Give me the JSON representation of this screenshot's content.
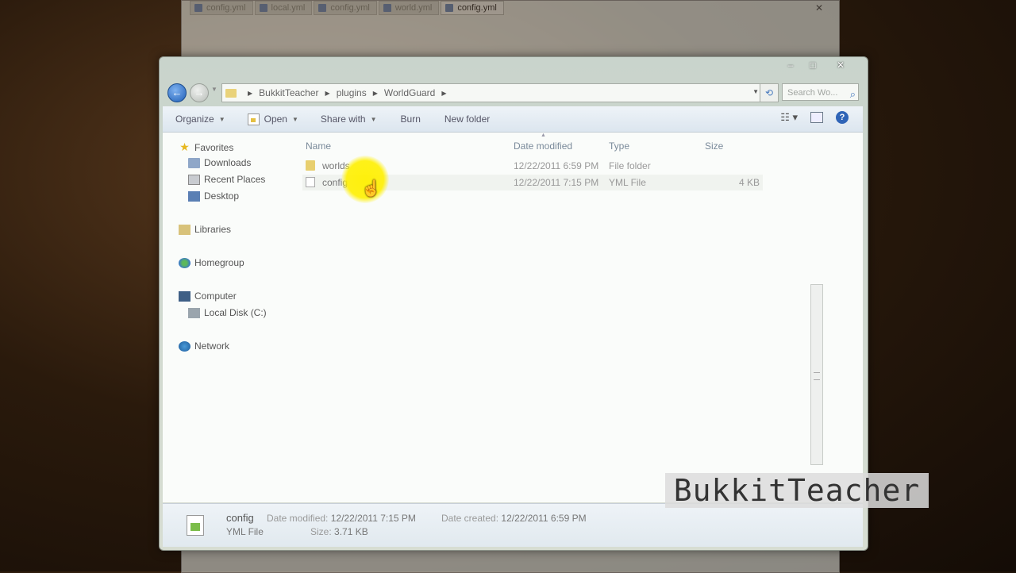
{
  "background_window": {
    "tabs": [
      "config.yml",
      "local.yml",
      "config.yml",
      "world.yml",
      "config.yml"
    ],
    "close_label": "✕"
  },
  "window": {
    "caption_minimize": "–",
    "caption_maximize": "□",
    "caption_close": "✕"
  },
  "address_bar": {
    "crumbs": [
      "BukkitTeacher",
      "plugins",
      "WorldGuard"
    ],
    "search_placeholder": "Search Wo..."
  },
  "toolbar": {
    "organize": "Organize",
    "open": "Open",
    "share_with": "Share with",
    "burn": "Burn",
    "new_folder": "New folder"
  },
  "nav_pane": {
    "favorites": "Favorites",
    "downloads": "Downloads",
    "recent_places": "Recent Places",
    "desktop": "Desktop",
    "libraries": "Libraries",
    "homegroup": "Homegroup",
    "computer": "Computer",
    "local_disk": "Local Disk (C:)",
    "network": "Network"
  },
  "file_list": {
    "columns": {
      "name": "Name",
      "date_modified": "Date modified",
      "type": "Type",
      "size": "Size"
    },
    "rows": [
      {
        "name": "worlds",
        "date": "12/22/2011 6:59 PM",
        "type": "File folder",
        "size": ""
      },
      {
        "name": "config",
        "date": "12/22/2011 7:15 PM",
        "type": "YML File",
        "size": "4 KB"
      }
    ]
  },
  "details": {
    "name": "config",
    "type": "YML File",
    "date_modified_label": "Date modified:",
    "date_modified": "12/22/2011 7:15 PM",
    "size_label": "Size:",
    "size": "3.71 KB",
    "date_created_label": "Date created:",
    "date_created": "12/22/2011 6:59 PM"
  },
  "watermark": "BukkitTeacher"
}
